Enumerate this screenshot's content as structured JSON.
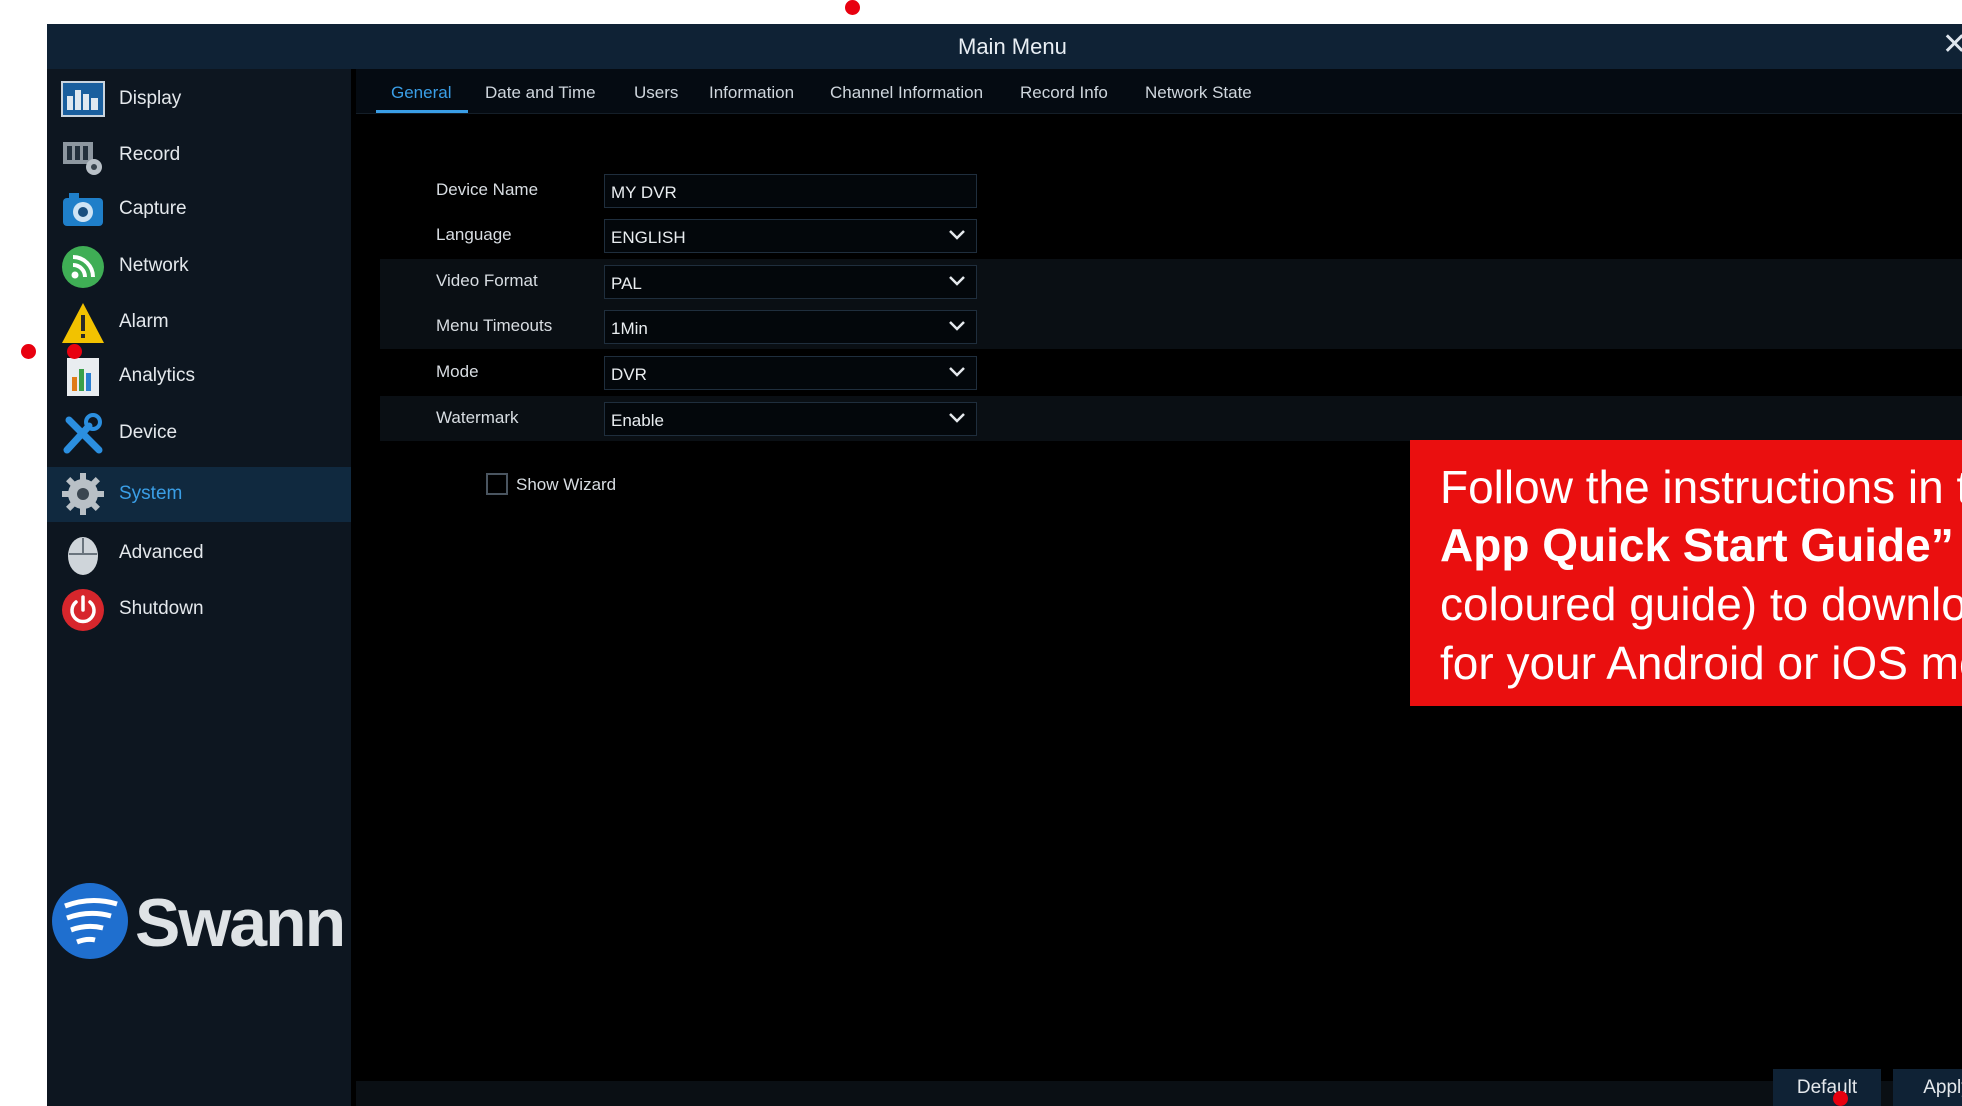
{
  "window": {
    "title": "Main Menu",
    "close_glyph": "✕"
  },
  "sidebar": {
    "items": [
      {
        "label": "Display",
        "icon": "display-icon"
      },
      {
        "label": "Record",
        "icon": "record-icon"
      },
      {
        "label": "Capture",
        "icon": "camera-icon"
      },
      {
        "label": "Network",
        "icon": "network-icon"
      },
      {
        "label": "Alarm",
        "icon": "alarm-warning-icon"
      },
      {
        "label": "Analytics",
        "icon": "analytics-icon"
      },
      {
        "label": "Device",
        "icon": "device-tools-icon"
      },
      {
        "label": "System",
        "icon": "gear-icon",
        "active": true
      },
      {
        "label": "Advanced",
        "icon": "mouse-icon"
      },
      {
        "label": "Shutdown",
        "icon": "power-icon"
      }
    ],
    "logo_text": "Swann"
  },
  "tabs": [
    {
      "label": "General",
      "active": true
    },
    {
      "label": "Date and Time"
    },
    {
      "label": "Users"
    },
    {
      "label": "Information"
    },
    {
      "label": "Channel Information"
    },
    {
      "label": "Record Info"
    },
    {
      "label": "Network State"
    }
  ],
  "form": {
    "device_name": {
      "label": "Device Name",
      "value": "MY DVR"
    },
    "language": {
      "label": "Language",
      "value": "ENGLISH"
    },
    "video_format": {
      "label": "Video Format",
      "value": "PAL"
    },
    "menu_timeouts": {
      "label": "Menu Timeouts",
      "value": "1Min"
    },
    "mode": {
      "label": "Mode",
      "value": "DVR"
    },
    "watermark": {
      "label": "Watermark",
      "value": "Enable"
    },
    "show_wizard": {
      "label": "Show Wizard",
      "checked": false
    }
  },
  "buttons": {
    "default": "Default",
    "apply": "Apply"
  },
  "callout": {
    "lines": [
      "Follow the instructions in the",
      "App Quick Start Guide” (",
      "coloured guide) to download",
      "for your Android or iOS mobile"
    ]
  },
  "colors": {
    "accent": "#3a9ee6",
    "titlebar": "#0f2235",
    "callout": "#ea0f0f",
    "marker": "#e8000f"
  }
}
